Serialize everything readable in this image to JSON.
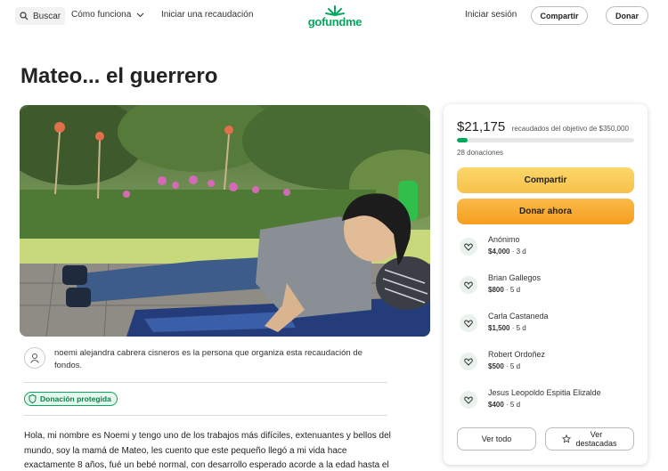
{
  "header": {
    "search_label": "Buscar",
    "how_label": "Cómo funciona",
    "start_label": "Iniciar una recaudación",
    "logo_text": "gofundme",
    "login_label": "Iniciar sesión",
    "share_label": "Compartir",
    "donate_label": "Donar"
  },
  "campaign": {
    "title": "Mateo... el guerrero",
    "organizer_text": "noemi alejandra cabrera cisneros es la persona que organiza esta recaudación de fondos.",
    "protected_badge": "Donación protegida",
    "story": "Hola, mi nombre es Noemi y tengo uno de los trabajos más difíciles, extenuantes y bellos del mundo, soy la mamá de Mateo, les cuento que este pequeño llegó a mi vida hace exactamente 8 años, fué un bebé normal, con desarrollo esperado acorde a la edad hasta el"
  },
  "card": {
    "raised_amount": "$21,175",
    "goal_text": "recaudados del objetivo de $350,000",
    "progress_fraction": 0.0605,
    "donations_count": "28 donaciones",
    "share_button": "Compartir",
    "donate_button": "Donar ahora",
    "donors": [
      {
        "name": "Anónimo",
        "amount": "$4,000",
        "when": "3 d"
      },
      {
        "name": "Brian Gallegos",
        "amount": "$800",
        "when": "5 d"
      },
      {
        "name": "Carla Castaneda",
        "amount": "$1,500",
        "when": "5 d"
      },
      {
        "name": "Robert Ordoñez",
        "amount": "$500",
        "when": "5 d"
      },
      {
        "name": "Jesus Leopoldo Espitia Elizalde",
        "amount": "$400",
        "when": "5 d"
      }
    ],
    "see_all": "Ver todo",
    "see_top_1": "Ver",
    "see_top_2": "destacadas"
  },
  "colors": {
    "brand": "#02a95c",
    "share_button": "#f7c14a",
    "donate_button": "#f59e1f"
  },
  "icons": [
    "search-icon",
    "chevron-down-icon",
    "gofundme-logo-icon",
    "user-icon",
    "shield-icon",
    "heart-hands-icon",
    "star-icon"
  ]
}
